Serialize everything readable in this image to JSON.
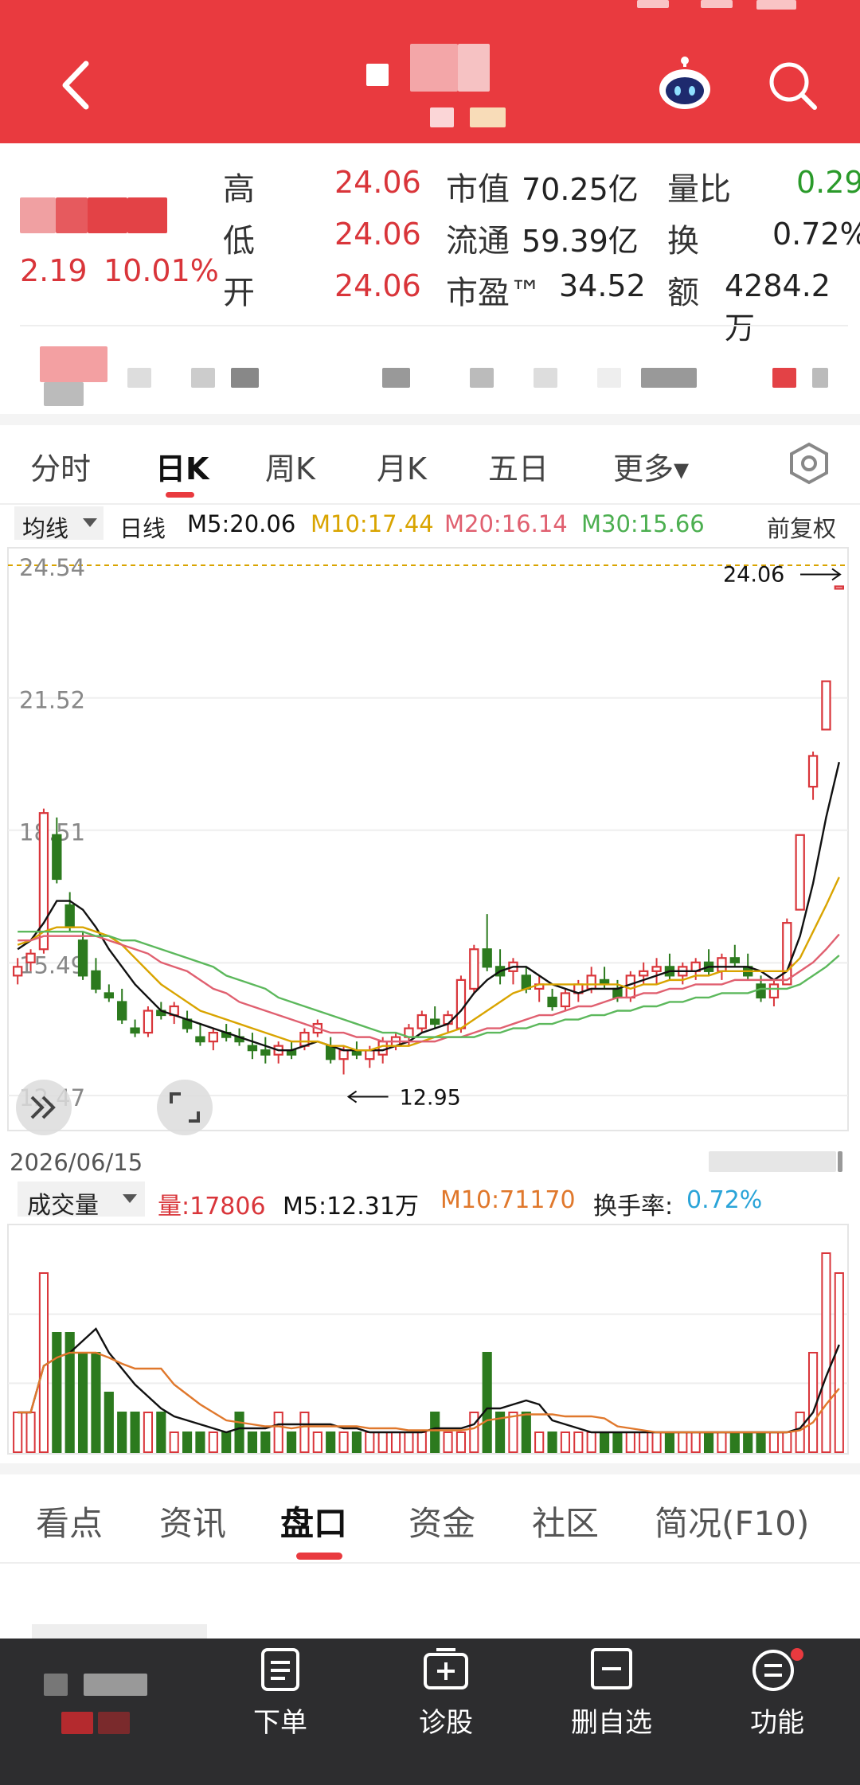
{
  "header": {
    "back_icon": "chevron-left-icon",
    "robot_icon": "robot-assistant-icon",
    "search_icon": "search-icon"
  },
  "quote": {
    "change": "2.19",
    "change_pct": "10.01%",
    "rows": [
      {
        "l1": "高",
        "v1": "24.06",
        "l2": "市值",
        "v2": "70.25亿",
        "l3": "量比",
        "v3": "0.29"
      },
      {
        "l1": "低",
        "v1": "24.06",
        "l2": "流通",
        "v2": "59.39亿",
        "l3": "换",
        "v3": "0.72%"
      },
      {
        "l1": "开",
        "v1": "24.06",
        "l2": "市盈™",
        "v2": "34.52",
        "l3": "额",
        "v3": "4284.2万"
      }
    ]
  },
  "kline_tabs": [
    "分时",
    "日K",
    "周K",
    "月K",
    "五日",
    "更多▾"
  ],
  "ma_bar": {
    "selector": "均线",
    "period": "日线",
    "m5": "M5:20.06",
    "m10": "M10:17.44",
    "m20": "M20:16.14",
    "m30": "M30:15.66",
    "adjust": "前复权"
  },
  "price_axis": [
    "24.54",
    "21.52",
    "18.51",
    "15.49",
    "12.47"
  ],
  "annotations": {
    "high": "24.06",
    "low": "12.95",
    "date": "2026/06/15"
  },
  "vol_bar": {
    "selector": "成交量",
    "vol": "量:17806",
    "m5": "M5:12.31万",
    "m10": "M10:71170",
    "turnover_label": "换手率:",
    "turnover": "0.72%"
  },
  "bottom_tabs": [
    "看点",
    "资讯",
    "盘口",
    "资金",
    "社区",
    "简况(F10)"
  ],
  "nav": [
    {
      "label": "下单",
      "icon": "order-document-icon"
    },
    {
      "label": "诊股",
      "icon": "diagnose-stock-icon"
    },
    {
      "label": "删自选",
      "icon": "remove-watchlist-icon"
    },
    {
      "label": "功能",
      "icon": "function-menu-icon"
    }
  ],
  "colors": {
    "up": "#d9353a",
    "down": "#2c7a1e",
    "accent": "#e93a3f",
    "m5": "#111111",
    "m10": "#d9a400",
    "m20": "#e06070",
    "m30": "#5cb85c"
  },
  "chart_data": {
    "type": "candlestick",
    "ylim": [
      12.47,
      24.54
    ],
    "yticks": [
      24.54,
      21.52,
      18.51,
      15.49,
      12.47
    ],
    "ohlc": [
      [
        15.2,
        15.6,
        15.0,
        15.4
      ],
      [
        15.5,
        15.8,
        15.3,
        15.7
      ],
      [
        15.8,
        19.0,
        15.7,
        18.9
      ],
      [
        18.4,
        18.8,
        17.3,
        17.4
      ],
      [
        16.8,
        17.1,
        16.2,
        16.3
      ],
      [
        16.0,
        16.2,
        15.1,
        15.2
      ],
      [
        15.3,
        15.6,
        14.8,
        14.9
      ],
      [
        14.8,
        15.0,
        14.6,
        14.7
      ],
      [
        14.6,
        14.9,
        14.1,
        14.2
      ],
      [
        14.0,
        14.2,
        13.8,
        13.9
      ],
      [
        13.9,
        14.5,
        13.8,
        14.4
      ],
      [
        14.4,
        14.6,
        14.2,
        14.3
      ],
      [
        14.3,
        14.6,
        14.1,
        14.5
      ],
      [
        14.2,
        14.4,
        13.9,
        14.0
      ],
      [
        13.8,
        14.1,
        13.6,
        13.7
      ],
      [
        13.7,
        14.0,
        13.5,
        13.9
      ],
      [
        13.9,
        14.1,
        13.7,
        13.8
      ],
      [
        13.8,
        14.0,
        13.6,
        13.7
      ],
      [
        13.6,
        13.9,
        13.3,
        13.5
      ],
      [
        13.5,
        13.8,
        13.2,
        13.4
      ],
      [
        13.4,
        13.7,
        13.2,
        13.6
      ],
      [
        13.5,
        13.7,
        13.3,
        13.4
      ],
      [
        13.6,
        14.0,
        13.5,
        13.9
      ],
      [
        13.9,
        14.2,
        13.8,
        14.1
      ],
      [
        13.6,
        13.8,
        13.2,
        13.3
      ],
      [
        13.3,
        13.6,
        12.95,
        13.5
      ],
      [
        13.5,
        13.7,
        13.3,
        13.4
      ],
      [
        13.3,
        13.6,
        13.1,
        13.5
      ],
      [
        13.4,
        13.8,
        13.2,
        13.7
      ],
      [
        13.6,
        13.9,
        13.5,
        13.8
      ],
      [
        13.8,
        14.1,
        13.6,
        14.0
      ],
      [
        14.0,
        14.4,
        13.9,
        14.3
      ],
      [
        14.2,
        14.5,
        14.0,
        14.1
      ],
      [
        14.1,
        14.4,
        13.9,
        14.3
      ],
      [
        14.0,
        15.2,
        13.9,
        15.1
      ],
      [
        14.9,
        15.9,
        14.8,
        15.8
      ],
      [
        15.8,
        16.6,
        15.3,
        15.4
      ],
      [
        15.4,
        15.8,
        15.0,
        15.2
      ],
      [
        15.3,
        15.6,
        15.0,
        15.5
      ],
      [
        15.2,
        15.4,
        14.8,
        14.9
      ],
      [
        14.9,
        15.2,
        14.6,
        15.0
      ],
      [
        14.7,
        14.9,
        14.4,
        14.5
      ],
      [
        14.5,
        14.9,
        14.4,
        14.8
      ],
      [
        14.8,
        15.1,
        14.6,
        15.0
      ],
      [
        14.9,
        15.4,
        14.8,
        15.2
      ],
      [
        15.1,
        15.4,
        14.9,
        15.0
      ],
      [
        14.9,
        15.1,
        14.6,
        14.7
      ],
      [
        14.7,
        15.3,
        14.6,
        15.2
      ],
      [
        15.2,
        15.5,
        15.0,
        15.3
      ],
      [
        15.3,
        15.6,
        15.0,
        15.4
      ],
      [
        15.4,
        15.7,
        15.1,
        15.2
      ],
      [
        15.2,
        15.5,
        15.0,
        15.4
      ],
      [
        15.3,
        15.6,
        15.1,
        15.5
      ],
      [
        15.5,
        15.8,
        15.2,
        15.3
      ],
      [
        15.3,
        15.7,
        15.1,
        15.6
      ],
      [
        15.6,
        15.9,
        15.4,
        15.5
      ],
      [
        15.4,
        15.7,
        15.1,
        15.2
      ],
      [
        15.0,
        15.2,
        14.6,
        14.7
      ],
      [
        14.7,
        15.1,
        14.5,
        15.0
      ],
      [
        15.0,
        16.5,
        15.0,
        16.4
      ],
      [
        16.7,
        18.4,
        16.7,
        18.4
      ],
      [
        19.5,
        20.3,
        19.2,
        20.2
      ],
      [
        20.8,
        21.9,
        20.8,
        21.9
      ],
      [
        24.06,
        24.06,
        24.06,
        24.06
      ]
    ],
    "series": [
      {
        "name": "M5",
        "values": [
          15.8,
          16.0,
          16.4,
          16.9,
          16.9,
          16.7,
          16.3,
          15.8,
          15.4,
          15.0,
          14.7,
          14.4,
          14.3,
          14.2,
          14.1,
          14.0,
          13.9,
          13.8,
          13.7,
          13.6,
          13.5,
          13.5,
          13.6,
          13.7,
          13.6,
          13.5,
          13.5,
          13.5,
          13.5,
          13.6,
          13.7,
          13.9,
          14.0,
          14.1,
          14.4,
          14.8,
          15.1,
          15.3,
          15.4,
          15.4,
          15.2,
          15.0,
          14.9,
          14.8,
          14.9,
          14.9,
          14.9,
          15.0,
          15.1,
          15.2,
          15.3,
          15.3,
          15.3,
          15.4,
          15.4,
          15.4,
          15.4,
          15.3,
          15.1,
          15.3,
          16.1,
          17.3,
          18.8,
          20.06
        ]
      },
      {
        "name": "M10",
        "values": [
          15.9,
          16.0,
          16.2,
          16.3,
          16.3,
          16.3,
          16.2,
          16.1,
          15.9,
          15.6,
          15.3,
          15.0,
          14.8,
          14.6,
          14.4,
          14.3,
          14.2,
          14.1,
          14.0,
          13.9,
          13.8,
          13.7,
          13.7,
          13.7,
          13.6,
          13.6,
          13.5,
          13.5,
          13.6,
          13.6,
          13.6,
          13.7,
          13.8,
          13.9,
          14.0,
          14.2,
          14.4,
          14.6,
          14.8,
          14.9,
          15.0,
          15.0,
          15.0,
          15.0,
          15.0,
          15.0,
          15.0,
          14.9,
          15.0,
          15.0,
          15.1,
          15.1,
          15.2,
          15.2,
          15.3,
          15.3,
          15.3,
          15.3,
          15.3,
          15.3,
          15.6,
          16.2,
          16.8,
          17.44
        ]
      },
      {
        "name": "M20",
        "values": [
          16.0,
          16.0,
          16.1,
          16.1,
          16.1,
          16.1,
          16.1,
          16.0,
          15.9,
          15.8,
          15.7,
          15.5,
          15.4,
          15.3,
          15.1,
          14.9,
          14.8,
          14.6,
          14.5,
          14.4,
          14.3,
          14.2,
          14.1,
          14.0,
          13.9,
          13.9,
          13.8,
          13.8,
          13.7,
          13.7,
          13.7,
          13.7,
          13.7,
          13.8,
          13.8,
          13.9,
          14.0,
          14.0,
          14.1,
          14.2,
          14.3,
          14.3,
          14.4,
          14.5,
          14.5,
          14.6,
          14.7,
          14.7,
          14.8,
          14.8,
          14.9,
          14.9,
          15.0,
          15.0,
          15.0,
          15.1,
          15.1,
          15.1,
          15.1,
          15.1,
          15.3,
          15.5,
          15.8,
          16.14
        ]
      },
      {
        "name": "M30",
        "values": [
          16.2,
          16.2,
          16.2,
          16.2,
          16.2,
          16.2,
          16.1,
          16.1,
          16.0,
          16.0,
          15.9,
          15.8,
          15.7,
          15.6,
          15.5,
          15.4,
          15.2,
          15.1,
          15.0,
          14.9,
          14.7,
          14.6,
          14.5,
          14.4,
          14.3,
          14.2,
          14.1,
          14.0,
          13.9,
          13.9,
          13.8,
          13.8,
          13.8,
          13.8,
          13.8,
          13.8,
          13.9,
          13.9,
          14.0,
          14.0,
          14.1,
          14.1,
          14.2,
          14.2,
          14.3,
          14.3,
          14.4,
          14.4,
          14.5,
          14.5,
          14.6,
          14.6,
          14.7,
          14.7,
          14.8,
          14.8,
          14.8,
          14.9,
          14.9,
          14.9,
          15.0,
          15.2,
          15.4,
          15.66
        ]
      }
    ],
    "volume": [
      {
        "values": [
          2,
          2,
          9,
          6,
          6,
          5,
          5,
          3,
          2,
          2,
          2,
          2,
          1,
          1,
          1,
          1,
          1,
          2,
          1,
          1,
          2,
          1,
          2,
          1,
          1,
          1,
          1,
          1,
          1,
          1,
          1,
          1,
          2,
          1,
          1,
          2,
          5,
          2,
          2,
          2,
          1,
          1,
          1,
          1,
          1,
          1,
          1,
          1,
          1,
          1,
          1,
          1,
          1,
          1,
          1,
          1,
          1,
          1,
          1,
          1,
          2,
          5,
          10,
          9
        ]
      }
    ]
  }
}
